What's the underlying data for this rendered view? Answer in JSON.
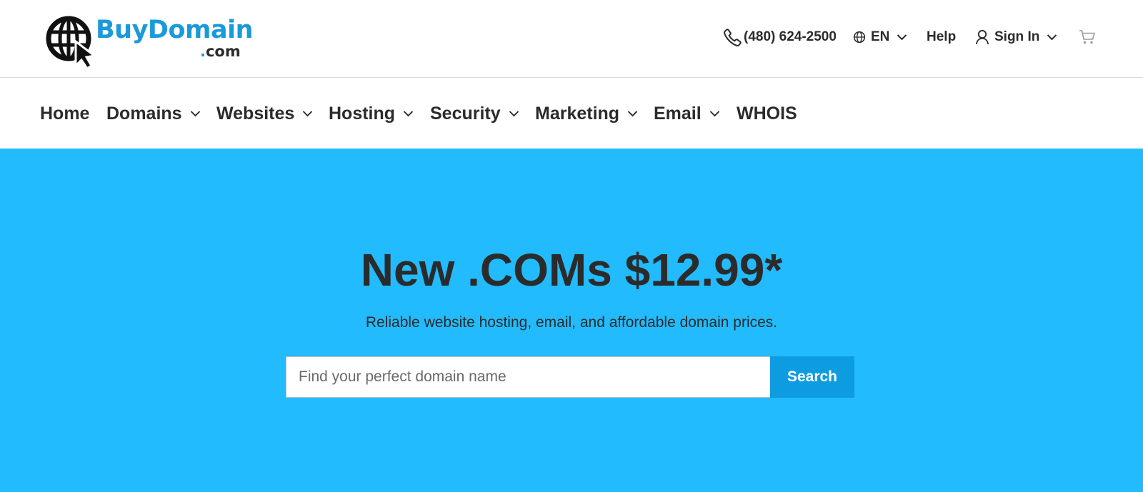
{
  "header": {
    "logo": {
      "main": "BuyDomain",
      "dot": ".",
      "sub": "com"
    },
    "phone": "(480) 624-2500",
    "language": "EN",
    "help": "Help",
    "sign_in": "Sign In",
    "icons": {
      "phone": "phone-icon",
      "language": "globe-icon",
      "account": "user-icon",
      "cart": "cart-icon",
      "dropdown": "chevron-down-icon"
    }
  },
  "nav": {
    "items": [
      {
        "label": "Home",
        "dropdown": false
      },
      {
        "label": "Domains",
        "dropdown": true
      },
      {
        "label": "Websites",
        "dropdown": true
      },
      {
        "label": "Hosting",
        "dropdown": true
      },
      {
        "label": "Security",
        "dropdown": true
      },
      {
        "label": "Marketing",
        "dropdown": true
      },
      {
        "label": "Email",
        "dropdown": true
      },
      {
        "label": "WHOIS",
        "dropdown": false
      }
    ]
  },
  "hero": {
    "title": "New .COMs $12.99*",
    "subtitle": "Reliable website hosting, email, and affordable domain prices.",
    "search_placeholder": "Find your perfect domain name",
    "search_button": "Search"
  },
  "colors": {
    "hero_background": "#22bbfd",
    "search_button": "#0e9ce0",
    "logo_accent": "#1a9ad9",
    "text": "#2b2b2b"
  }
}
